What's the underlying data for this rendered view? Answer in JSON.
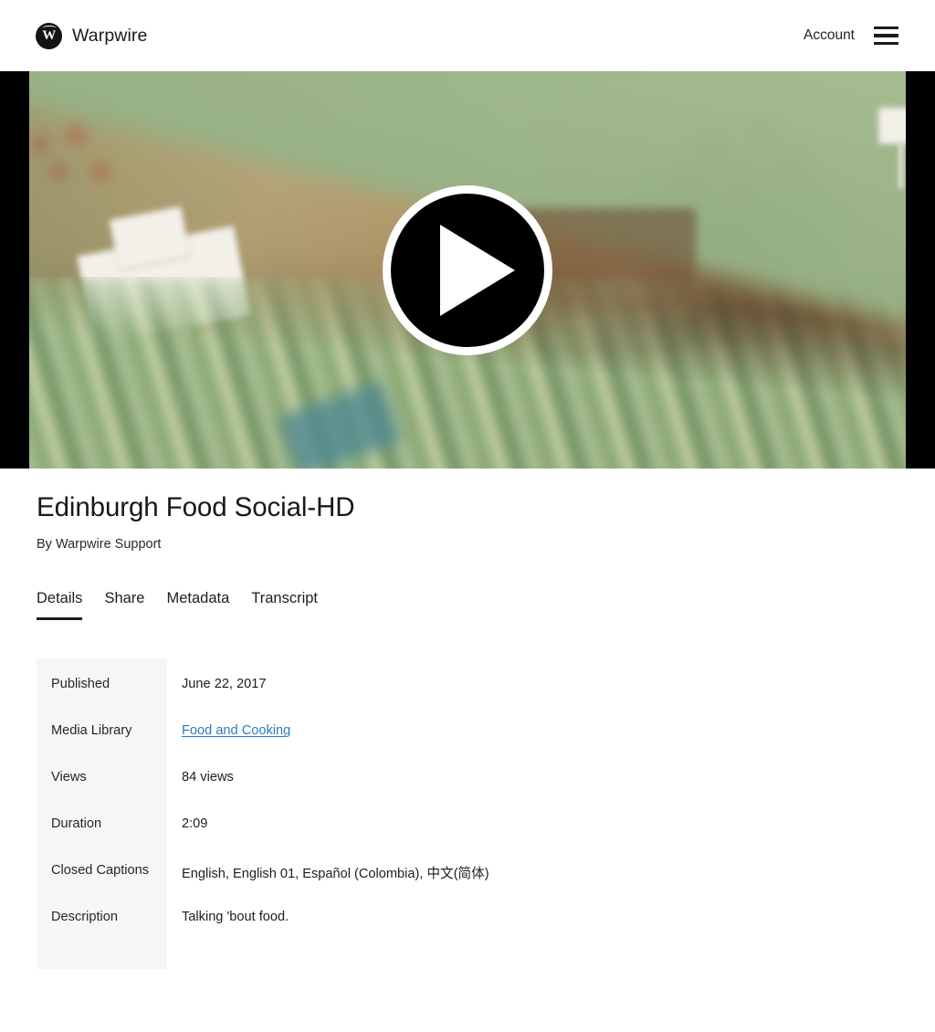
{
  "header": {
    "brand_name": "Warpwire",
    "brand_glyph": "W",
    "account_label": "Account",
    "menu_icon": "hamburger-menu-icon"
  },
  "player": {
    "play_icon": "play-triangle-icon",
    "poster_description": "Blurred farmers market stall with wicker baskets of tomatoes, red peppers, cabbages and green leeks",
    "state": "paused",
    "letterbox_color": "#000000"
  },
  "media": {
    "title": "Edinburgh Food Social-HD",
    "byline": "By Warpwire Support"
  },
  "tabs": [
    {
      "label": "Details",
      "active": true
    },
    {
      "label": "Share",
      "active": false
    },
    {
      "label": "Metadata",
      "active": false
    },
    {
      "label": "Transcript",
      "active": false
    }
  ],
  "details": {
    "rows": [
      {
        "key": "Published",
        "value": "June 22, 2017",
        "type": "text"
      },
      {
        "key": "Media Library",
        "value": "Food and Cooking",
        "type": "link"
      },
      {
        "key": "Views",
        "value": "84 views",
        "type": "text"
      },
      {
        "key": "Duration",
        "value": "2:09",
        "type": "text"
      },
      {
        "key": "Closed Captions",
        "value": "English, English 01, Español (Colombia), 中文(简体)",
        "type": "text"
      },
      {
        "key": "Description",
        "value": "Talking 'bout food.",
        "type": "text"
      }
    ]
  },
  "colors": {
    "link": "#2b7bc0",
    "key_cell_background": "#f6f6f6",
    "text": "#1c1c1c",
    "accent_underline": "#1c1c1c"
  }
}
